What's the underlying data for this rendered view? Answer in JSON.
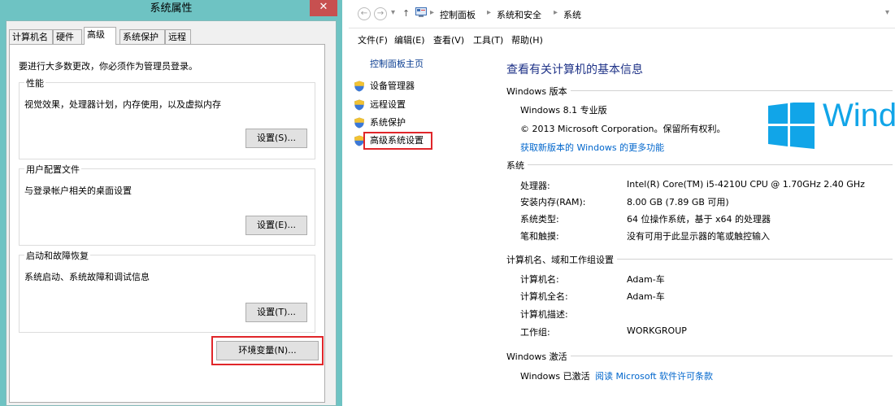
{
  "dialog": {
    "title": "系统属性",
    "close_glyph": "✕",
    "tabs": [
      "计算机名",
      "硬件",
      "高级",
      "系统保护",
      "远程"
    ],
    "active_tab": "高级",
    "admin_note": "要进行大多数更改，你必须作为管理员登录。",
    "groups": [
      {
        "title": "性能",
        "description": "视觉效果，处理器计划，内存使用，以及虚拟内存",
        "button": "设置(S)..."
      },
      {
        "title": "用户配置文件",
        "description": "与登录帐户相关的桌面设置",
        "button": "设置(E)..."
      },
      {
        "title": "启动和故障恢复",
        "description": "系统启动、系统故障和调试信息",
        "button": "设置(T)..."
      }
    ],
    "env_button": "环境变量(N)..."
  },
  "explorer": {
    "nav_back": "←",
    "nav_forward": "→",
    "nav_up": "↑",
    "breadcrumb": [
      "控制面板",
      "系统和安全",
      "系统"
    ],
    "menu": [
      "文件(F)",
      "编辑(E)",
      "查看(V)",
      "工具(T)",
      "帮助(H)"
    ],
    "sidebar": {
      "home": "控制面板主页",
      "links": [
        "设备管理器",
        "远程设置",
        "系统保护",
        "高级系统设置"
      ],
      "highlighted": "高级系统设置"
    },
    "main": {
      "title": "查看有关计算机的基本信息",
      "windows_edition": {
        "section": "Windows 版本",
        "edition": "Windows 8.1 专业版",
        "copyright": "© 2013 Microsoft Corporation。保留所有权利。",
        "more_features_link": "获取新版本的 Windows 的更多功能",
        "logo_text": "Wind"
      },
      "system": {
        "section": "系统",
        "rows": [
          {
            "label": "处理器:",
            "value": "Intel(R) Core(TM) i5-4210U CPU @ 1.70GHz   2.40 GHz"
          },
          {
            "label": "安装内存(RAM):",
            "value": "8.00 GB (7.89 GB 可用)"
          },
          {
            "label": "系统类型:",
            "value": "64 位操作系统，基于 x64 的处理器"
          },
          {
            "label": "笔和触摸:",
            "value": "没有可用于此显示器的笔或触控输入"
          }
        ]
      },
      "computer": {
        "section": "计算机名、域和工作组设置",
        "rows": [
          {
            "label": "计算机名:",
            "value": "Adam-车"
          },
          {
            "label": "计算机全名:",
            "value": "Adam-车"
          },
          {
            "label": "计算机描述:",
            "value": ""
          },
          {
            "label": "工作组:",
            "value": "WORKGROUP"
          }
        ]
      },
      "activation": {
        "section": "Windows 激活",
        "status": "Windows 已激活",
        "license_link": "阅读 Microsoft 软件许可条款"
      }
    }
  },
  "colors": {
    "dialog_frame": "#6ec3c3",
    "close_button": "#c75050",
    "highlight_box": "#e0262a",
    "link": "#0066cc",
    "title_blue": "#1e3287",
    "windows_logo": "#11a5e8"
  }
}
